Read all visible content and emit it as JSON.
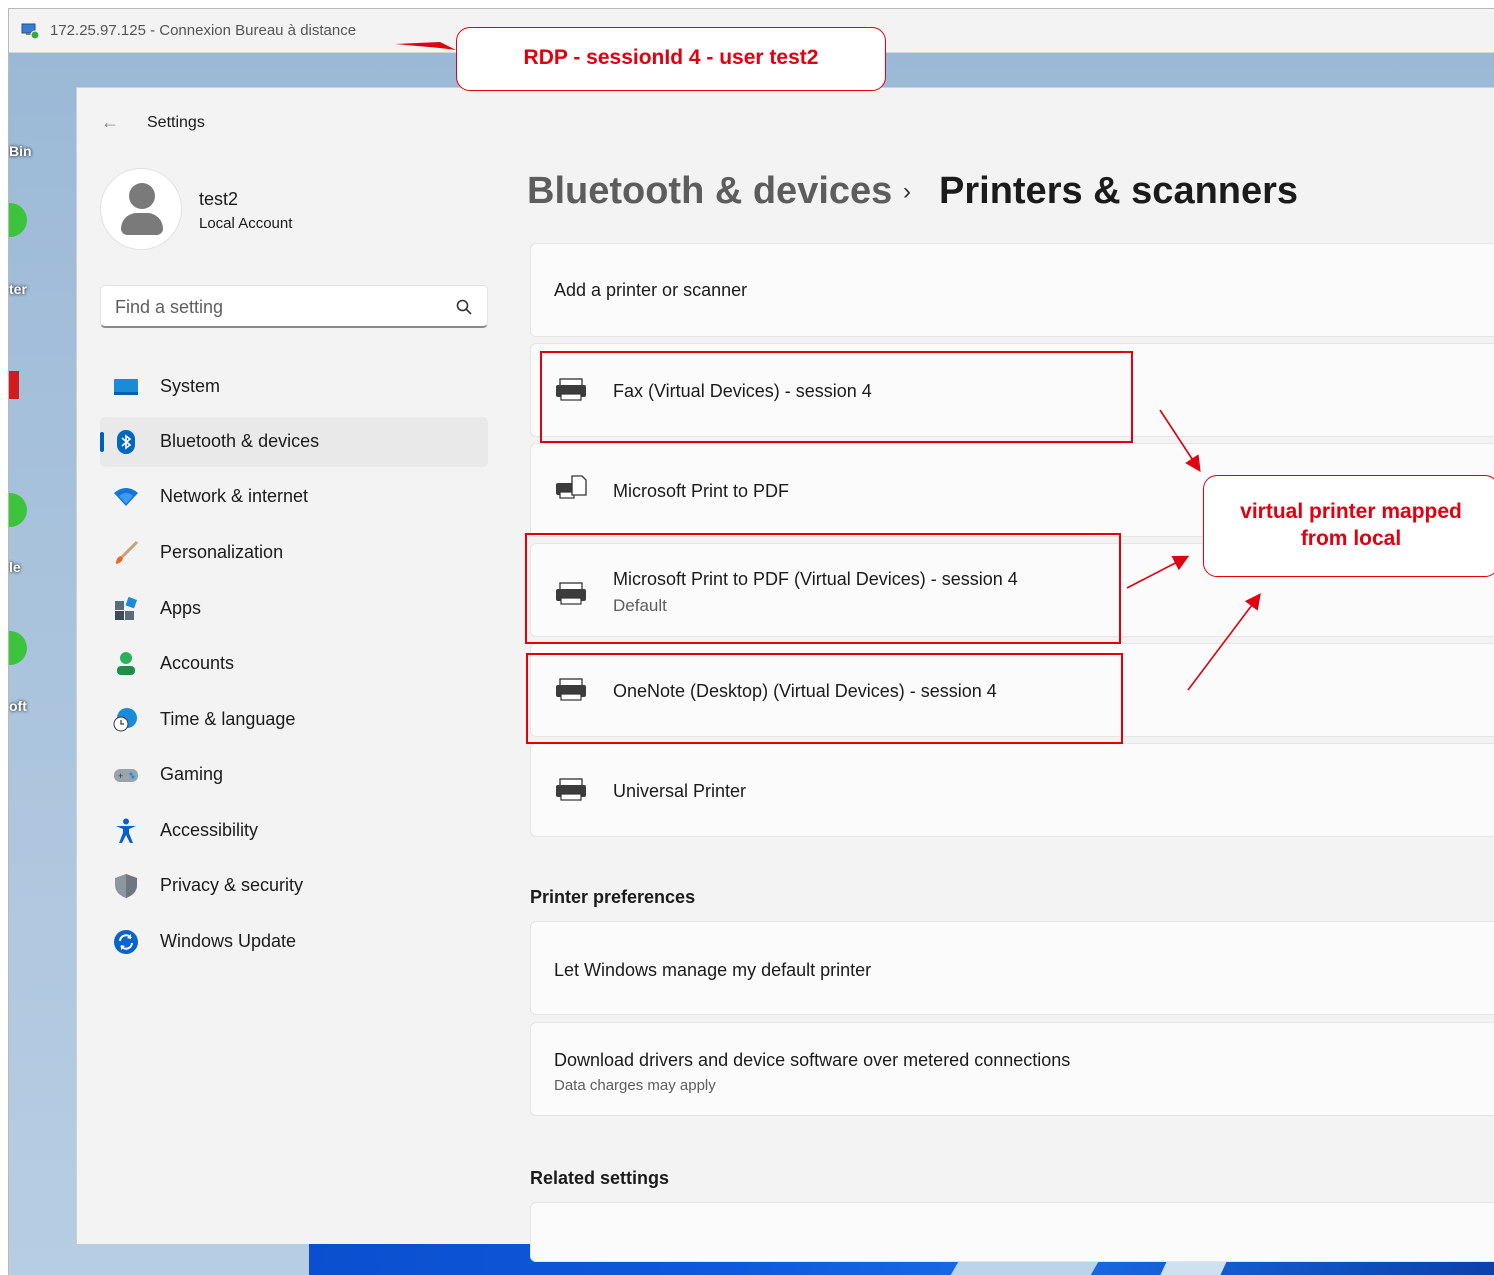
{
  "rdp_window": {
    "title": "172.25.97.125 - Connexion Bureau à distance"
  },
  "desktop": {
    "labels": [
      "Bin",
      "ter",
      "le",
      "oft"
    ]
  },
  "annotations": {
    "session_callout": "RDP - sessionId 4 - user test2",
    "mapped_callout_line1": "virtual printer mapped",
    "mapped_callout_line2": "from local",
    "annotation_color": "#e0000f"
  },
  "settings": {
    "app_title": "Settings",
    "user": {
      "name": "test2",
      "account_type": "Local Account"
    },
    "search": {
      "placeholder": "Find a setting"
    },
    "nav": [
      {
        "label": "System",
        "icon": "system-icon"
      },
      {
        "label": "Bluetooth & devices",
        "icon": "bluetooth-icon",
        "active": true
      },
      {
        "label": "Network & internet",
        "icon": "wifi-icon"
      },
      {
        "label": "Personalization",
        "icon": "brush-icon"
      },
      {
        "label": "Apps",
        "icon": "apps-icon"
      },
      {
        "label": "Accounts",
        "icon": "person-icon"
      },
      {
        "label": "Time & language",
        "icon": "globe-clock-icon"
      },
      {
        "label": "Gaming",
        "icon": "gamepad-icon"
      },
      {
        "label": "Accessibility",
        "icon": "accessibility-icon"
      },
      {
        "label": "Privacy & security",
        "icon": "shield-icon"
      },
      {
        "label": "Windows Update",
        "icon": "refresh-icon"
      }
    ],
    "breadcrumb": {
      "parent": "Bluetooth & devices",
      "separator": "›",
      "current": "Printers & scanners"
    },
    "add_printer": "Add a printer or scanner",
    "printers": [
      {
        "name": "Fax (Virtual Devices) - session 4",
        "status": ""
      },
      {
        "name": "Microsoft Print to PDF",
        "status": ""
      },
      {
        "name": "Microsoft Print to PDF (Virtual Devices) - session 4",
        "status": "Default"
      },
      {
        "name": "OneNote (Desktop) (Virtual Devices) - session 4",
        "status": ""
      },
      {
        "name": "Universal Printer",
        "status": ""
      }
    ],
    "printer_preferences": {
      "title": "Printer preferences",
      "manage_default": "Let Windows manage my default printer",
      "download_drivers": "Download drivers and device software over metered connections",
      "download_drivers_sub": "Data charges may apply"
    },
    "related_settings": {
      "title": "Related settings"
    },
    "accent_color": "#005fb8"
  }
}
